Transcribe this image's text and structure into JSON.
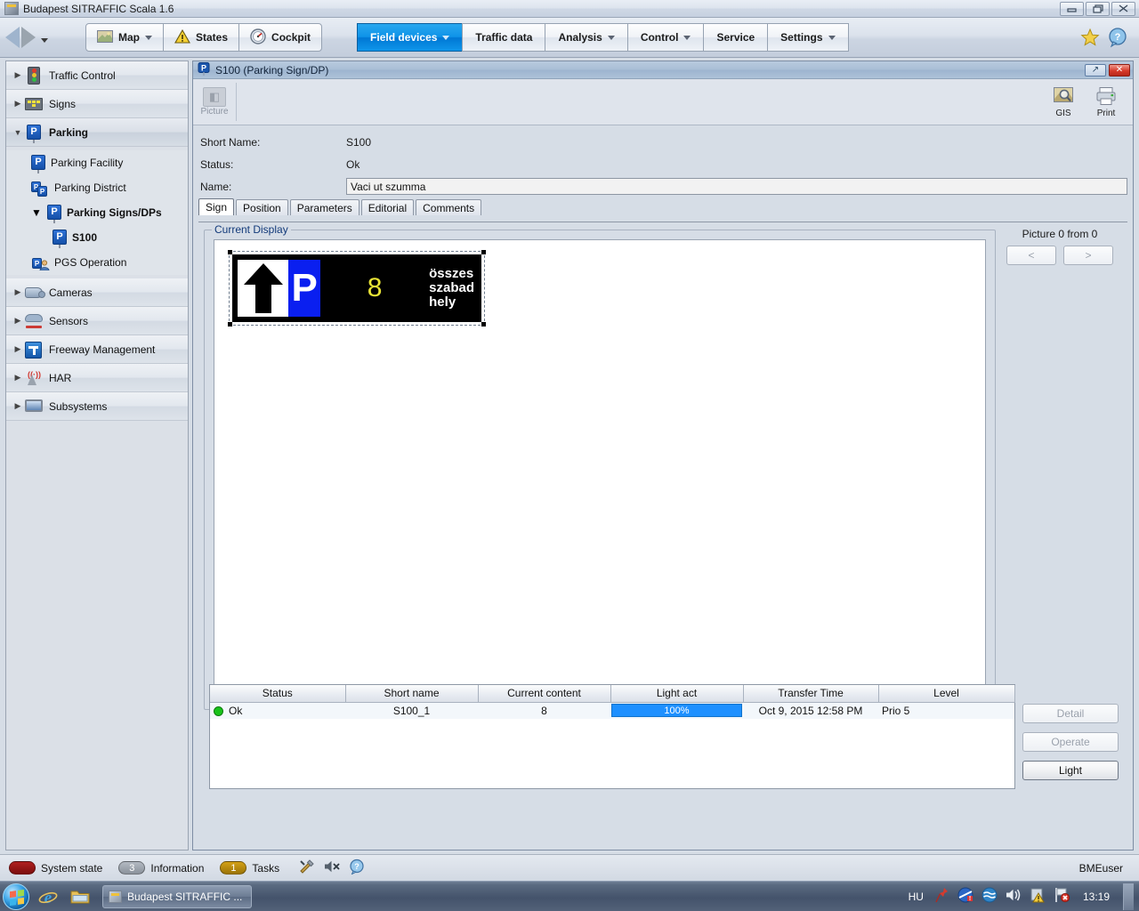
{
  "window": {
    "title": "Budapest SITRAFFIC Scala 1.6",
    "minimize": "—",
    "maximize": "❐",
    "close": "✕"
  },
  "toolbar": {
    "groups": [
      {
        "items": [
          {
            "label": "Map",
            "icon": "map-icon",
            "caret": true
          }
        ]
      },
      {
        "items": [
          {
            "label": "States",
            "icon": "warning-icon",
            "caret": false
          }
        ]
      },
      {
        "items": [
          {
            "label": "Cockpit",
            "icon": "gauge-icon",
            "caret": false
          }
        ]
      }
    ],
    "menus": [
      {
        "label": "Field devices",
        "caret": true,
        "active": true
      },
      {
        "label": "Traffic data",
        "caret": false,
        "active": false
      },
      {
        "label": "Analysis",
        "caret": true,
        "active": false
      },
      {
        "label": "Control",
        "caret": true,
        "active": false
      },
      {
        "label": "Service",
        "caret": false,
        "active": false
      },
      {
        "label": "Settings",
        "caret": true,
        "active": false
      }
    ],
    "right_icons": [
      "favorite-star-icon",
      "help-icon"
    ]
  },
  "sidebar": {
    "items": [
      {
        "label": "Traffic Control",
        "icon": "traffic-light-icon",
        "expanded": false,
        "level": 0
      },
      {
        "label": "Signs",
        "icon": "sign-board-icon",
        "expanded": false,
        "level": 0
      },
      {
        "label": "Parking",
        "icon": "parking-icon",
        "expanded": true,
        "level": 0,
        "selected": true
      },
      {
        "label": "Parking Facility",
        "icon": "parking-icon",
        "level": 1
      },
      {
        "label": "Parking District",
        "icon": "parking-district-icon",
        "level": 1
      },
      {
        "label": "Parking Signs/DPs",
        "icon": "parking-sign-icon",
        "expanded": true,
        "level": 1,
        "bold": true
      },
      {
        "label": "S100",
        "icon": "parking-sign-icon",
        "level": 2,
        "bold": true
      },
      {
        "label": "PGS Operation",
        "icon": "pgs-operation-icon",
        "level": 1
      },
      {
        "label": "Cameras",
        "icon": "camera-icon",
        "expanded": false,
        "level": 0
      },
      {
        "label": "Sensors",
        "icon": "sensor-icon",
        "expanded": false,
        "level": 0
      },
      {
        "label": "Freeway Management",
        "icon": "freeway-icon",
        "expanded": false,
        "level": 0
      },
      {
        "label": "HAR",
        "icon": "har-antenna-icon",
        "expanded": false,
        "level": 0
      },
      {
        "label": "Subsystems",
        "icon": "monitor-icon",
        "expanded": false,
        "level": 0
      }
    ]
  },
  "document": {
    "title": "S100 (Parking Sign/DP)",
    "restore_label": "↗",
    "close_label": "✕",
    "toolbar": {
      "picture_label": "Picture",
      "gis_label": "GIS",
      "print_label": "Print"
    },
    "fields": {
      "short_name_label": "Short Name:",
      "short_name_value": "S100",
      "status_label": "Status:",
      "status_value": "Ok",
      "name_label": "Name:",
      "name_value": "Vaci ut szumma",
      "name_placeholder": ""
    },
    "tabs": [
      {
        "label": "Sign",
        "selected": true
      },
      {
        "label": "Position",
        "selected": false
      },
      {
        "label": "Parameters",
        "selected": false
      },
      {
        "label": "Editorial",
        "selected": false
      },
      {
        "label": "Comments",
        "selected": false
      }
    ],
    "group_legend": "Current Display",
    "sign": {
      "arrow": "straight-arrow-up",
      "p_symbol": "P",
      "p_background": "#0a1ff0",
      "lcd_number": "8",
      "lcd_number_color": "#e9e436",
      "caption_line1": "összes",
      "caption_line2": "szabad hely"
    },
    "picture_nav": {
      "label": "Picture 0 from 0",
      "prev": "<",
      "next": ">"
    },
    "table": {
      "columns": [
        "Status",
        "Short name",
        "Current content",
        "Light act",
        "Transfer Time",
        "Level"
      ],
      "rows": [
        {
          "status": "Ok",
          "status_color": "#19c21a",
          "short_name": "S100_1",
          "current_content": "8",
          "light_act": "100%",
          "light_act_pct": 100,
          "transfer_time": "Oct 9, 2015 12:58 PM",
          "level": "Prio 5"
        }
      ]
    },
    "side_buttons": [
      {
        "label": "Detail",
        "enabled": false
      },
      {
        "label": "Operate",
        "enabled": false
      },
      {
        "label": "Light",
        "enabled": true
      }
    ]
  },
  "statusbar": {
    "system_state_label": "System state",
    "system_state_color": "#8b1414",
    "information_count": "3",
    "information_label": "Information",
    "tasks_count": "1",
    "tasks_label": "Tasks",
    "icons": [
      "tools-icon",
      "mute-icon",
      "help-icon"
    ],
    "user": "BMEuser"
  },
  "taskbar": {
    "start_label": "Start",
    "pinned": [
      "internet-explorer-icon",
      "file-explorer-icon"
    ],
    "items": [
      {
        "label": "Budapest SITRAFFIC ...",
        "icon": "app-icon",
        "active": true
      }
    ],
    "tray": {
      "language": "HU",
      "icons": [
        "pin-icon",
        "network-warning-icon",
        "blue-wave-icon",
        "volume-icon",
        "action-center-icon",
        "flag-error-icon"
      ],
      "clock": "13:19"
    }
  }
}
